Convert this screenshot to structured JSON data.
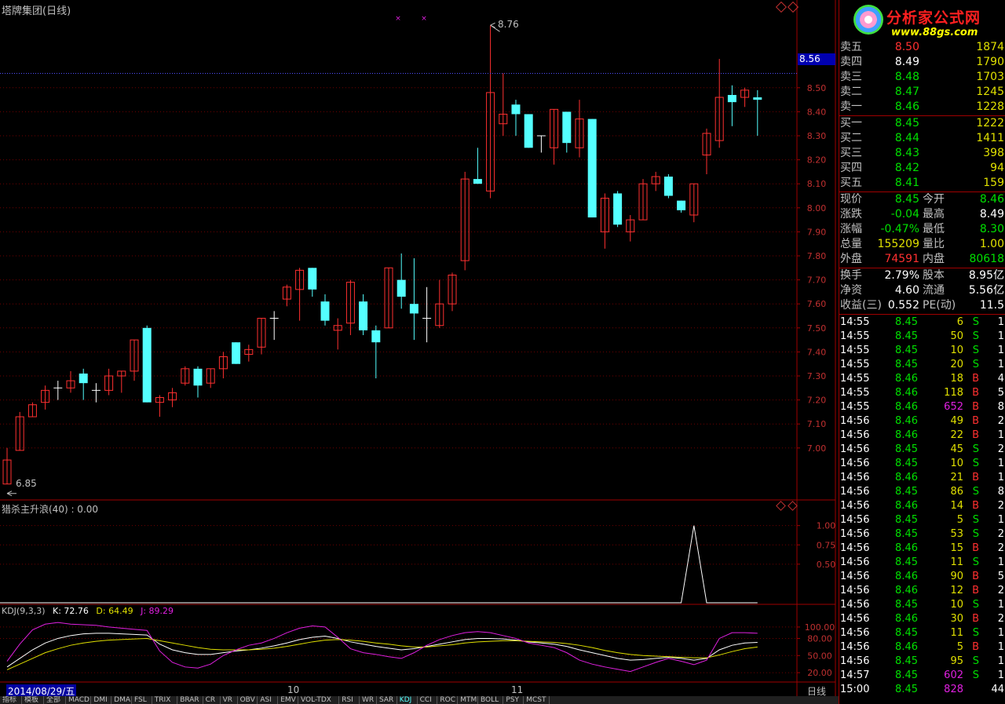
{
  "window": {
    "title": "塔牌集团(日线)",
    "period_label": "日线",
    "date_label": "2014/08/29/五",
    "month_labels": [
      "10",
      "11"
    ]
  },
  "logo": {
    "text": "分析家公式网",
    "url": "www.88gs.com",
    "colors": {
      "text": "#ff2020",
      "url": "#ffff00"
    }
  },
  "colors": {
    "up": "#ff3030",
    "down": "#54ffff",
    "frame": "#a00000",
    "k": "#ffffff",
    "d": "#e0e000",
    "j": "#e020e0"
  },
  "main_chart": {
    "high_marker": "8.76",
    "low_marker": "6.85",
    "price_tag": "8.56"
  },
  "indicator1": {
    "title": "猎杀主升浪(40) : 0.00"
  },
  "indicator2": {
    "name": "KDJ(9,3,3)",
    "k_label": "K: 72.76",
    "d_label": "D: 64.49",
    "j_label": "J: 89.29"
  },
  "chart_data": [
    {
      "type": "candlestick",
      "ylim": [
        6.8,
        8.8
      ],
      "ticks": [
        "7.00",
        "7.10",
        "7.20",
        "7.30",
        "7.40",
        "7.50",
        "7.60",
        "7.70",
        "7.80",
        "7.90",
        "8.00",
        "8.10",
        "8.20",
        "8.30",
        "8.40",
        "8.50"
      ],
      "candles": [
        {
          "o": 6.85,
          "h": 7.0,
          "l": 6.85,
          "c": 6.95
        },
        {
          "o": 6.99,
          "h": 7.15,
          "l": 6.99,
          "c": 7.13
        },
        {
          "o": 7.13,
          "h": 7.19,
          "l": 7.13,
          "c": 7.18
        },
        {
          "o": 7.19,
          "h": 7.26,
          "l": 7.16,
          "c": 7.24
        },
        {
          "o": 7.25,
          "h": 7.28,
          "l": 7.2,
          "c": 7.25
        },
        {
          "o": 7.25,
          "h": 7.32,
          "l": 7.23,
          "c": 7.28
        },
        {
          "o": 7.31,
          "h": 7.33,
          "l": 7.2,
          "c": 7.27
        },
        {
          "o": 7.24,
          "h": 7.27,
          "l": 7.19,
          "c": 7.24
        },
        {
          "o": 7.24,
          "h": 7.33,
          "l": 7.22,
          "c": 7.3
        },
        {
          "o": 7.3,
          "h": 7.32,
          "l": 7.23,
          "c": 7.32
        },
        {
          "o": 7.32,
          "h": 7.45,
          "l": 7.28,
          "c": 7.45
        },
        {
          "o": 7.5,
          "h": 7.51,
          "l": 7.19,
          "c": 7.19
        },
        {
          "o": 7.19,
          "h": 7.22,
          "l": 7.13,
          "c": 7.21
        },
        {
          "o": 7.2,
          "h": 7.25,
          "l": 7.17,
          "c": 7.23
        },
        {
          "o": 7.27,
          "h": 7.34,
          "l": 7.26,
          "c": 7.33
        },
        {
          "o": 7.33,
          "h": 7.34,
          "l": 7.21,
          "c": 7.26
        },
        {
          "o": 7.27,
          "h": 7.33,
          "l": 7.25,
          "c": 7.33
        },
        {
          "o": 7.33,
          "h": 7.4,
          "l": 7.29,
          "c": 7.38
        },
        {
          "o": 7.44,
          "h": 7.44,
          "l": 7.35,
          "c": 7.35
        },
        {
          "o": 7.39,
          "h": 7.43,
          "l": 7.36,
          "c": 7.41
        },
        {
          "o": 7.42,
          "h": 7.54,
          "l": 7.39,
          "c": 7.54
        },
        {
          "o": 7.54,
          "h": 7.57,
          "l": 7.45,
          "c": 7.54
        },
        {
          "o": 7.62,
          "h": 7.68,
          "l": 7.59,
          "c": 7.67
        },
        {
          "o": 7.66,
          "h": 7.75,
          "l": 7.53,
          "c": 7.74
        },
        {
          "o": 7.75,
          "h": 7.75,
          "l": 7.63,
          "c": 7.66
        },
        {
          "o": 7.61,
          "h": 7.64,
          "l": 7.51,
          "c": 7.53
        },
        {
          "o": 7.49,
          "h": 7.54,
          "l": 7.41,
          "c": 7.51
        },
        {
          "o": 7.52,
          "h": 7.7,
          "l": 7.47,
          "c": 7.69
        },
        {
          "o": 7.61,
          "h": 7.64,
          "l": 7.47,
          "c": 7.49
        },
        {
          "o": 7.49,
          "h": 7.51,
          "l": 7.29,
          "c": 7.44
        },
        {
          "o": 7.5,
          "h": 7.75,
          "l": 7.5,
          "c": 7.75
        },
        {
          "o": 7.7,
          "h": 7.81,
          "l": 7.58,
          "c": 7.63
        },
        {
          "o": 7.6,
          "h": 7.79,
          "l": 7.45,
          "c": 7.56
        },
        {
          "o": 7.54,
          "h": 7.67,
          "l": 7.44,
          "c": 7.54
        },
        {
          "o": 7.51,
          "h": 7.7,
          "l": 7.5,
          "c": 7.6
        },
        {
          "o": 7.6,
          "h": 7.73,
          "l": 7.57,
          "c": 7.72
        },
        {
          "o": 7.78,
          "h": 8.15,
          "l": 7.74,
          "c": 8.12
        },
        {
          "o": 8.12,
          "h": 8.25,
          "l": 8.1,
          "c": 8.1
        },
        {
          "o": 8.07,
          "h": 8.76,
          "l": 8.04,
          "c": 8.48
        },
        {
          "o": 8.35,
          "h": 8.56,
          "l": 8.3,
          "c": 8.39
        },
        {
          "o": 8.43,
          "h": 8.45,
          "l": 8.3,
          "c": 8.39
        },
        {
          "o": 8.39,
          "h": 8.39,
          "l": 8.25,
          "c": 8.25
        },
        {
          "o": 8.3,
          "h": 8.3,
          "l": 8.23,
          "c": 8.3
        },
        {
          "o": 8.25,
          "h": 8.41,
          "l": 8.18,
          "c": 8.41
        },
        {
          "o": 8.4,
          "h": 8.4,
          "l": 8.23,
          "c": 8.27
        },
        {
          "o": 8.25,
          "h": 8.45,
          "l": 8.21,
          "c": 8.37
        },
        {
          "o": 8.37,
          "h": 8.37,
          "l": 7.96,
          "c": 7.96
        },
        {
          "o": 7.9,
          "h": 8.06,
          "l": 7.83,
          "c": 8.04
        },
        {
          "o": 8.06,
          "h": 8.07,
          "l": 7.92,
          "c": 7.93
        },
        {
          "o": 7.9,
          "h": 7.97,
          "l": 7.86,
          "c": 7.95
        },
        {
          "o": 7.95,
          "h": 8.12,
          "l": 7.95,
          "c": 8.1
        },
        {
          "o": 8.1,
          "h": 8.15,
          "l": 8.07,
          "c": 8.13
        },
        {
          "o": 8.13,
          "h": 8.14,
          "l": 8.04,
          "c": 8.05
        },
        {
          "o": 8.03,
          "h": 8.03,
          "l": 7.98,
          "c": 7.99
        },
        {
          "o": 7.97,
          "h": 8.1,
          "l": 7.94,
          "c": 8.1
        },
        {
          "o": 8.22,
          "h": 8.33,
          "l": 8.14,
          "c": 8.31
        },
        {
          "o": 8.28,
          "h": 8.62,
          "l": 8.25,
          "c": 8.46
        },
        {
          "o": 8.47,
          "h": 8.51,
          "l": 8.34,
          "c": 8.44
        },
        {
          "o": 8.46,
          "h": 8.5,
          "l": 8.42,
          "c": 8.49
        },
        {
          "o": 8.46,
          "h": 8.49,
          "l": 8.3,
          "c": 8.45
        }
      ]
    },
    {
      "type": "line",
      "title": "猎杀主升浪(40) : 0.00",
      "ylim": [
        0,
        1.2
      ],
      "ticks": [
        "0.50",
        "0.75",
        "1.00"
      ],
      "series": [
        {
          "values": [
            0,
            0,
            0,
            0,
            0,
            0,
            0,
            0,
            0,
            0,
            0,
            0,
            0,
            0,
            0,
            0,
            0,
            0,
            0,
            0,
            0,
            0,
            0,
            0,
            0,
            0,
            0,
            0,
            0,
            0,
            0,
            0,
            0,
            0,
            0,
            0,
            0,
            0,
            0,
            0,
            0,
            0,
            0,
            0,
            0,
            0,
            0,
            0,
            0,
            0,
            0,
            0,
            0,
            0,
            0,
            0,
            0,
            0,
            0,
            0
          ]
        }
      ],
      "spikes": [
        {
          "index": 54,
          "value": 1.0
        }
      ]
    },
    {
      "type": "line",
      "title": "KDJ(9,3,3)",
      "ylim": [
        0,
        120
      ],
      "ticks": [
        "20.00",
        "50.00",
        "80.00",
        "100.00"
      ],
      "series": [
        {
          "name": "K",
          "values": [
            30,
            45,
            60,
            72,
            80,
            85,
            88,
            89,
            89,
            88,
            87,
            86,
            70,
            60,
            55,
            52,
            52,
            55,
            58,
            60,
            63,
            67,
            72,
            78,
            82,
            84,
            80,
            74,
            70,
            66,
            63,
            60,
            62,
            66,
            70,
            74,
            78,
            80,
            80,
            79,
            77,
            74,
            72,
            70,
            66,
            60,
            55,
            50,
            45,
            42,
            43,
            45,
            47,
            45,
            42,
            45,
            60,
            68,
            72,
            73
          ]
        },
        {
          "name": "D",
          "values": [
            25,
            35,
            45,
            55,
            62,
            68,
            72,
            75,
            77,
            78,
            79,
            80,
            76,
            72,
            68,
            64,
            61,
            60,
            60,
            60,
            61,
            63,
            66,
            70,
            74,
            77,
            78,
            77,
            75,
            72,
            70,
            67,
            65,
            65,
            67,
            69,
            72,
            74,
            75,
            76,
            76,
            75,
            74,
            73,
            71,
            68,
            64,
            59,
            55,
            52,
            50,
            49,
            48,
            47,
            46,
            46,
            51,
            57,
            62,
            65
          ]
        },
        {
          "name": "J",
          "values": [
            40,
            70,
            95,
            105,
            108,
            105,
            104,
            103,
            100,
            98,
            96,
            94,
            58,
            38,
            30,
            28,
            35,
            50,
            60,
            68,
            72,
            80,
            90,
            98,
            102,
            100,
            82,
            62,
            55,
            52,
            48,
            45,
            55,
            68,
            78,
            85,
            90,
            92,
            90,
            85,
            80,
            72,
            68,
            64,
            55,
            42,
            35,
            30,
            26,
            22,
            30,
            38,
            45,
            40,
            34,
            42,
            80,
            90,
            90,
            89
          ]
        }
      ]
    }
  ],
  "order_book": {
    "sell": [
      {
        "label": "卖五",
        "price": "8.50",
        "vol": "1874"
      },
      {
        "label": "卖四",
        "price": "8.49",
        "vol": "1790"
      },
      {
        "label": "卖三",
        "price": "8.48",
        "vol": "1703"
      },
      {
        "label": "卖二",
        "price": "8.47",
        "vol": "1245"
      },
      {
        "label": "卖一",
        "price": "8.46",
        "vol": "1228"
      }
    ],
    "buy": [
      {
        "label": "买一",
        "price": "8.45",
        "vol": "1222"
      },
      {
        "label": "买二",
        "price": "8.44",
        "vol": "1411"
      },
      {
        "label": "买三",
        "price": "8.43",
        "vol": "398"
      },
      {
        "label": "买四",
        "price": "8.42",
        "vol": "94"
      },
      {
        "label": "买五",
        "price": "8.41",
        "vol": "159"
      }
    ]
  },
  "quote": [
    {
      "l1": "现价",
      "v1": "8.45",
      "c1": "g",
      "l2": "今开",
      "v2": "8.46",
      "c2": "g"
    },
    {
      "l1": "涨跌",
      "v1": "-0.04",
      "c1": "g",
      "l2": "最高",
      "v2": "8.49",
      "c2": "w"
    },
    {
      "l1": "涨幅",
      "v1": "-0.47%",
      "c1": "g",
      "l2": "最低",
      "v2": "8.30",
      "c2": "g"
    },
    {
      "l1": "总量",
      "v1": "155209",
      "c1": "y",
      "l2": "量比",
      "v2": "1.00",
      "c2": "y"
    },
    {
      "l1": "外盘",
      "v1": "74591",
      "c1": "r",
      "l2": "内盘",
      "v2": "80618",
      "c2": "g"
    }
  ],
  "fundamentals": [
    {
      "l1": "换手",
      "v1": "2.79%",
      "l2": "股本",
      "v2": "8.95亿"
    },
    {
      "l1": "净资",
      "v1": "4.60",
      "l2": "流通",
      "v2": "5.56亿"
    },
    {
      "l1": "收益(三)",
      "v1": "0.552",
      "l2": "PE(动)",
      "v2": "11.5"
    }
  ],
  "ticks": [
    {
      "t": "14:55",
      "p": "8.45",
      "pc": "g",
      "v": "6",
      "vc": "y",
      "s": "S",
      "n": "1"
    },
    {
      "t": "14:55",
      "p": "8.45",
      "pc": "g",
      "v": "50",
      "vc": "y",
      "s": "S",
      "n": "1"
    },
    {
      "t": "14:55",
      "p": "8.45",
      "pc": "g",
      "v": "10",
      "vc": "y",
      "s": "S",
      "n": "1"
    },
    {
      "t": "14:55",
      "p": "8.45",
      "pc": "g",
      "v": "20",
      "vc": "y",
      "s": "S",
      "n": "1"
    },
    {
      "t": "14:55",
      "p": "8.46",
      "pc": "g",
      "v": "18",
      "vc": "y",
      "s": "B",
      "n": "4"
    },
    {
      "t": "14:55",
      "p": "8.46",
      "pc": "g",
      "v": "118",
      "vc": "y",
      "s": "B",
      "n": "5"
    },
    {
      "t": "14:55",
      "p": "8.46",
      "pc": "g",
      "v": "652",
      "vc": "m",
      "s": "B",
      "n": "8"
    },
    {
      "t": "14:56",
      "p": "8.46",
      "pc": "g",
      "v": "49",
      "vc": "y",
      "s": "B",
      "n": "2"
    },
    {
      "t": "14:56",
      "p": "8.46",
      "pc": "g",
      "v": "22",
      "vc": "y",
      "s": "B",
      "n": "1"
    },
    {
      "t": "14:56",
      "p": "8.45",
      "pc": "g",
      "v": "45",
      "vc": "y",
      "s": "S",
      "n": "2"
    },
    {
      "t": "14:56",
      "p": "8.45",
      "pc": "g",
      "v": "10",
      "vc": "y",
      "s": "S",
      "n": "1"
    },
    {
      "t": "14:56",
      "p": "8.46",
      "pc": "g",
      "v": "21",
      "vc": "y",
      "s": "B",
      "n": "1"
    },
    {
      "t": "14:56",
      "p": "8.45",
      "pc": "g",
      "v": "86",
      "vc": "y",
      "s": "S",
      "n": "8"
    },
    {
      "t": "14:56",
      "p": "8.46",
      "pc": "g",
      "v": "14",
      "vc": "y",
      "s": "B",
      "n": "2"
    },
    {
      "t": "14:56",
      "p": "8.45",
      "pc": "g",
      "v": "5",
      "vc": "y",
      "s": "S",
      "n": "1"
    },
    {
      "t": "14:56",
      "p": "8.45",
      "pc": "g",
      "v": "53",
      "vc": "y",
      "s": "S",
      "n": "2"
    },
    {
      "t": "14:56",
      "p": "8.46",
      "pc": "g",
      "v": "15",
      "vc": "y",
      "s": "B",
      "n": "2"
    },
    {
      "t": "14:56",
      "p": "8.45",
      "pc": "g",
      "v": "11",
      "vc": "y",
      "s": "S",
      "n": "1"
    },
    {
      "t": "14:56",
      "p": "8.46",
      "pc": "g",
      "v": "90",
      "vc": "y",
      "s": "B",
      "n": "5"
    },
    {
      "t": "14:56",
      "p": "8.46",
      "pc": "g",
      "v": "12",
      "vc": "y",
      "s": "B",
      "n": "2"
    },
    {
      "t": "14:56",
      "p": "8.45",
      "pc": "g",
      "v": "10",
      "vc": "y",
      "s": "S",
      "n": "1"
    },
    {
      "t": "14:56",
      "p": "8.46",
      "pc": "g",
      "v": "30",
      "vc": "y",
      "s": "B",
      "n": "2"
    },
    {
      "t": "14:56",
      "p": "8.45",
      "pc": "g",
      "v": "11",
      "vc": "y",
      "s": "S",
      "n": "1"
    },
    {
      "t": "14:56",
      "p": "8.46",
      "pc": "g",
      "v": "5",
      "vc": "y",
      "s": "B",
      "n": "1"
    },
    {
      "t": "14:56",
      "p": "8.45",
      "pc": "g",
      "v": "95",
      "vc": "y",
      "s": "S",
      "n": "1"
    },
    {
      "t": "14:57",
      "p": "8.45",
      "pc": "g",
      "v": "602",
      "vc": "m",
      "s": "S",
      "n": "1"
    },
    {
      "t": "15:00",
      "p": "8.45",
      "pc": "g",
      "v": "828",
      "vc": "m",
      "s": "",
      "n": "44"
    }
  ],
  "tabs": [
    "指标",
    "模板",
    "全部",
    "MACD",
    "DMI",
    "DMA",
    "FSL",
    "TRIX",
    "BRAR",
    "CR",
    "VR",
    "OBV",
    "ASI",
    "EMV",
    "VOL-TDX",
    "RSI",
    "WR",
    "SAR",
    "KDJ",
    "CCI",
    "ROC",
    "MTM",
    "BOLL",
    "PSY",
    "MCST"
  ]
}
